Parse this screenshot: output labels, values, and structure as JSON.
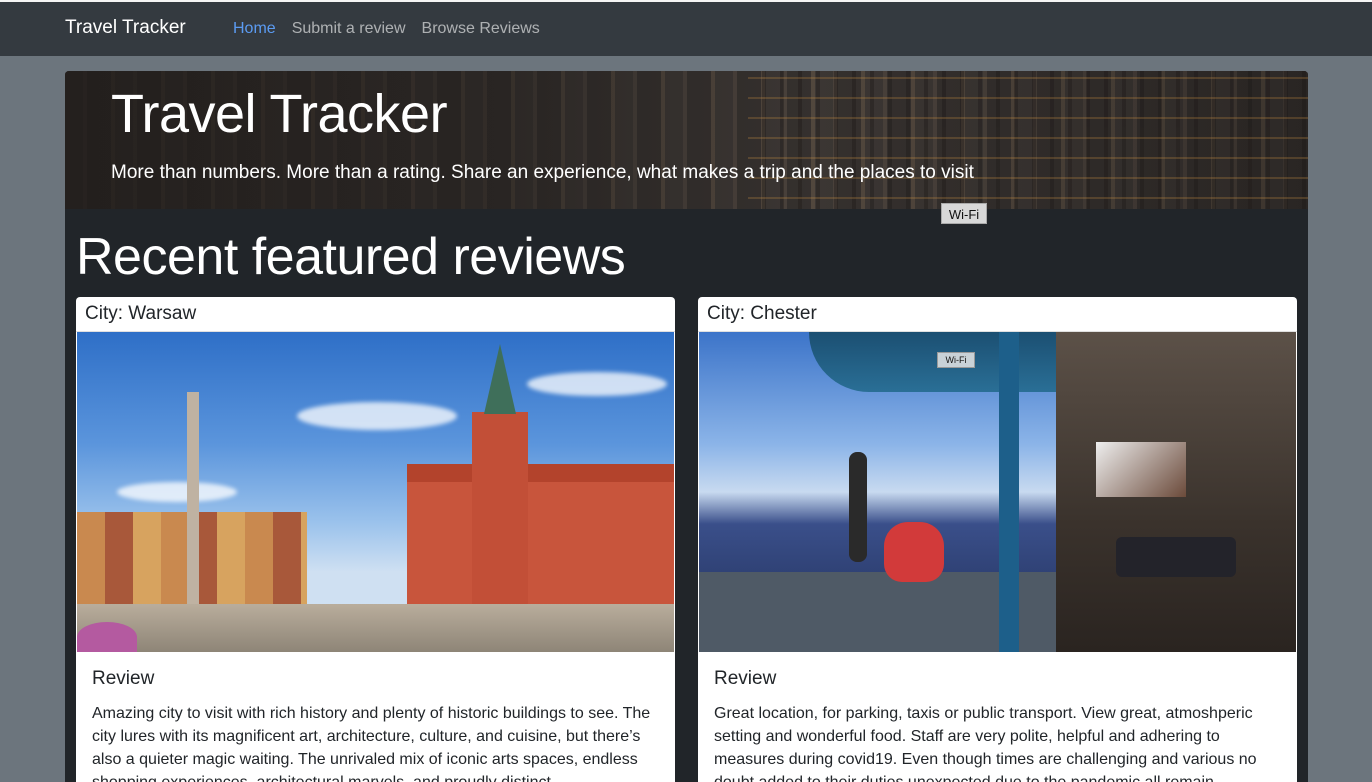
{
  "navbar": {
    "brand": "Travel Tracker",
    "links": [
      {
        "label": "Home",
        "active": true
      },
      {
        "label": "Submit a review",
        "active": false
      },
      {
        "label": "Browse Reviews",
        "active": false
      }
    ]
  },
  "hero": {
    "title": "Travel Tracker",
    "lead": "More than numbers. More than a rating. Share an experience, what makes a trip and the places to visit",
    "tooltip": "Wi-Fi"
  },
  "section": {
    "title": "Recent featured reviews"
  },
  "cards": [
    {
      "header": "City: Warsaw",
      "review_heading": "Review",
      "review_text": "Amazing city to visit with rich history and plenty of historic buildings to see. The city lures with its magnificent art, architecture, culture, and cuisine, but there’s also a quieter magic waiting. The unrivaled mix of iconic arts spaces, endless shopping experiences, architectural marvels, and proudly distinct"
    },
    {
      "header": "City: Chester",
      "review_heading": "Review",
      "review_text": "Great location, for parking, taxis or public transport. View great, atmoshperic setting and wonderful food. Staff are very polite, helpful and adhering to measures during covid19. Even though times are challenging and various no doubt added to their duties unexpected due to the pandemic all remain",
      "image_tag": "Wi-Fi"
    }
  ],
  "colors": {
    "navbar_bg": "#343a40",
    "page_bg": "#6c757d",
    "container_bg": "#212529",
    "active_link": "#5b9bf2"
  }
}
